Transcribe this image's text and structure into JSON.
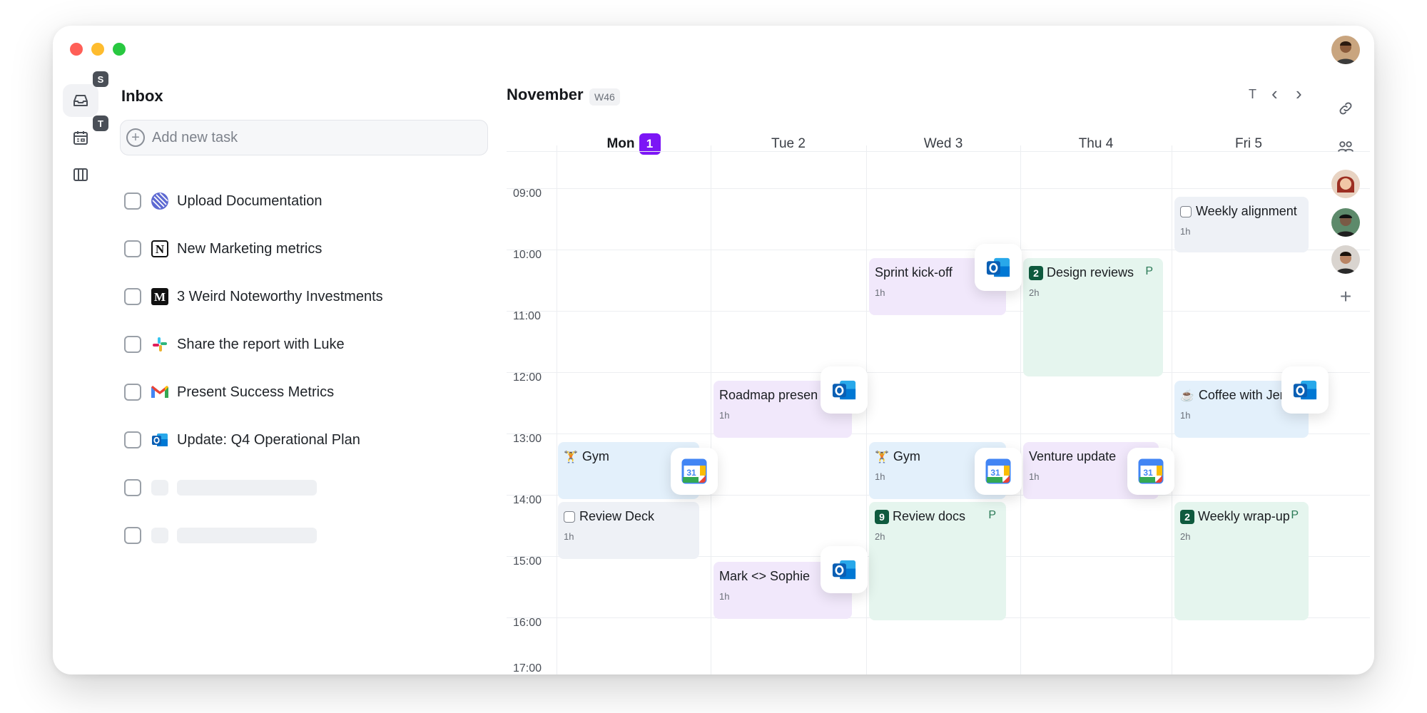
{
  "sidebar": {
    "badges": {
      "inbox": "S",
      "calendar": "T"
    }
  },
  "inbox": {
    "title": "Inbox",
    "add_task_placeholder": "Add new task",
    "tasks": [
      {
        "label": "Upload Documentation",
        "app": "linear-icon"
      },
      {
        "label": "New Marketing metrics",
        "app": "notion-icon"
      },
      {
        "label": "3 Weird Noteworthy Investments",
        "app": "medium-icon"
      },
      {
        "label": "Share the report with Luke",
        "app": "slack-icon"
      },
      {
        "label": "Present Success Metrics",
        "app": "gmail-icon"
      },
      {
        "label": "Update: Q4 Operational Plan",
        "app": "outlook-icon"
      }
    ]
  },
  "calendar": {
    "month": "November",
    "week": "W46",
    "today_button": "T",
    "prev_symbol": "‹",
    "next_symbol": "›",
    "days": [
      {
        "label": "Mon",
        "date_badge": "1",
        "today": true
      },
      {
        "label": "Tue 2"
      },
      {
        "label": "Wed 3"
      },
      {
        "label": "Thu 4"
      },
      {
        "label": "Fri 5"
      }
    ],
    "times": [
      "09:00",
      "10:00",
      "11:00",
      "12:00",
      "13:00",
      "14:00",
      "15:00",
      "16:00",
      "17:00"
    ],
    "events": [
      {
        "title": "Weekly alignment",
        "duration": "1h",
        "day": "Fri",
        "start": "09:00",
        "end": "10:00",
        "color": "gray",
        "checkbox": true
      },
      {
        "title": "Sprint kick-off",
        "duration": "1h",
        "day": "Wed",
        "start": "10:00",
        "end": "11:00",
        "color": "purple",
        "source": "outlook"
      },
      {
        "title": "Design reviews",
        "duration": "2h",
        "day": "Thu",
        "start": "10:00",
        "end": "12:00",
        "color": "green",
        "badge": "2",
        "tag": "P"
      },
      {
        "title": "Roadmap presen",
        "duration": "1h",
        "day": "Tue",
        "start": "12:00",
        "end": "13:00",
        "color": "purple",
        "source": "outlook"
      },
      {
        "title": "Coffee with Jen",
        "duration": "1h",
        "day": "Fri",
        "start": "12:00",
        "end": "13:00",
        "color": "blue",
        "emoji": "☕",
        "source": "outlook"
      },
      {
        "title": "Gym",
        "duration": "1h",
        "day": "Mon",
        "start": "13:00",
        "end": "14:00",
        "color": "blue",
        "emoji": "🏋",
        "source": "google-calendar"
      },
      {
        "title": "Gym",
        "duration": "1h",
        "day": "Wed",
        "start": "13:00",
        "end": "14:00",
        "color": "blue",
        "emoji": "🏋",
        "source": "google-calendar"
      },
      {
        "title": "Venture update",
        "duration": "1h",
        "day": "Thu",
        "start": "13:00",
        "end": "14:00",
        "color": "purple",
        "source": "google-calendar"
      },
      {
        "title": "Review Deck",
        "duration": "1h",
        "day": "Mon",
        "start": "14:00",
        "end": "15:00",
        "color": "gray",
        "checkbox": true
      },
      {
        "title": "Review docs",
        "duration": "2h",
        "day": "Wed",
        "start": "14:00",
        "end": "16:00",
        "color": "green",
        "badge": "9",
        "tag": "P"
      },
      {
        "title": "Weekly wrap-up",
        "duration": "2h",
        "day": "Fri",
        "start": "14:00",
        "end": "16:00",
        "color": "green",
        "badge": "2",
        "tag": "P"
      },
      {
        "title": "Mark <> Sophie",
        "duration": "1h",
        "day": "Tue",
        "start": "15:00",
        "end": "16:00",
        "color": "purple",
        "source": "outlook"
      }
    ]
  },
  "right_rail": {
    "add_symbol": "+"
  },
  "colors": {
    "accent": "#7c16f5",
    "event_purple": "#f1e8fb",
    "event_green": "#e5f5ee",
    "event_blue": "#e3f0fb",
    "event_gray": "#eef1f6",
    "badge_green": "#0f5a3e"
  }
}
